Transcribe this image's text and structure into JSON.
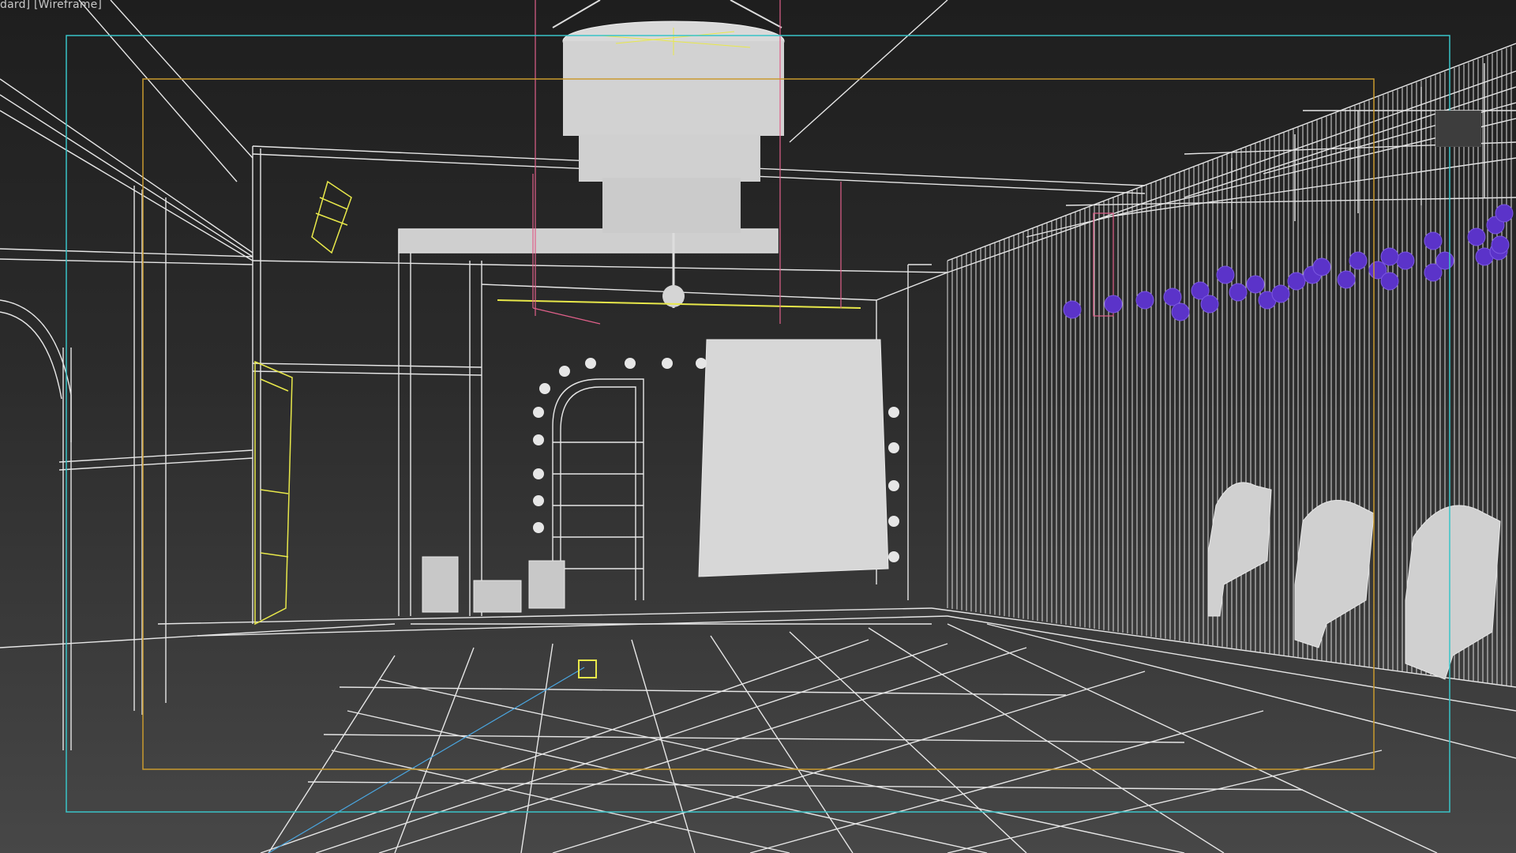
{
  "viewport": {
    "label": "dard] [Wireframe]",
    "mode": "Wireframe"
  },
  "scene": {
    "safe_frame_outer_color": "#39c4c8",
    "safe_frame_inner_color": "#c99a2e",
    "wire_color": "#e6e6e6",
    "selected_wire_color": "#e8e84a",
    "light_color": "#6a3fd0",
    "camera_color": "#e8e84a",
    "target_line_color": "#4aa6e0",
    "pink_box_color": "#e0608a"
  },
  "icons": {
    "corner_gizmo": "viewcube-icon",
    "chandelier": "chandelier-icon",
    "lights": "spotlight-icon",
    "chairs": "chair-icon",
    "camera": "camera-icon"
  }
}
